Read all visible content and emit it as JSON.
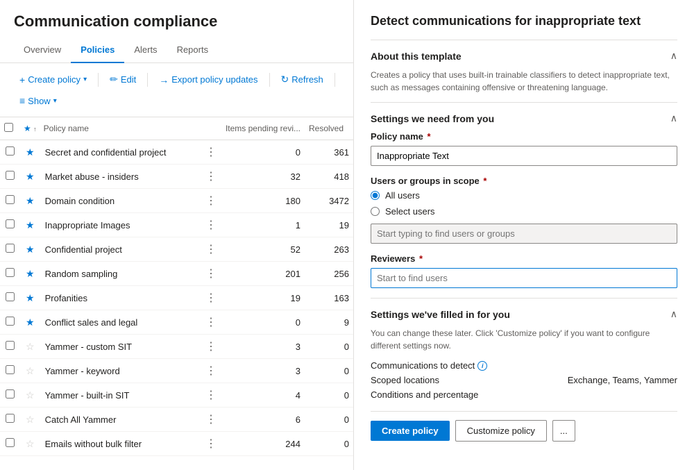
{
  "app": {
    "title": "Communication compliance"
  },
  "nav": {
    "tabs": [
      {
        "id": "overview",
        "label": "Overview",
        "active": false
      },
      {
        "id": "policies",
        "label": "Policies",
        "active": true
      },
      {
        "id": "alerts",
        "label": "Alerts",
        "active": false
      },
      {
        "id": "reports",
        "label": "Reports",
        "active": false
      }
    ]
  },
  "toolbar": {
    "create_label": "Create policy",
    "edit_label": "Edit",
    "export_label": "Export policy updates",
    "refresh_label": "Refresh",
    "show_label": "Show"
  },
  "table": {
    "headers": {
      "name": "Policy name",
      "items_pending": "Items pending revi...",
      "resolved": "Resolved"
    },
    "rows": [
      {
        "name": "Secret and confidential project",
        "starred": true,
        "items_pending": 0,
        "resolved": 361
      },
      {
        "name": "Market abuse - insiders",
        "starred": true,
        "items_pending": 32,
        "resolved": 418
      },
      {
        "name": "Domain condition",
        "starred": true,
        "items_pending": 180,
        "resolved": 3472
      },
      {
        "name": "Inappropriate Images",
        "starred": true,
        "items_pending": 1,
        "resolved": 19
      },
      {
        "name": "Confidential project",
        "starred": true,
        "items_pending": 52,
        "resolved": 263
      },
      {
        "name": "Random sampling",
        "starred": true,
        "items_pending": 201,
        "resolved": 256
      },
      {
        "name": "Profanities",
        "starred": true,
        "items_pending": 19,
        "resolved": 163
      },
      {
        "name": "Conflict sales and legal",
        "starred": true,
        "items_pending": 0,
        "resolved": 9
      },
      {
        "name": "Yammer - custom SIT",
        "starred": false,
        "items_pending": 3,
        "resolved": 0
      },
      {
        "name": "Yammer - keyword",
        "starred": false,
        "items_pending": 3,
        "resolved": 0
      },
      {
        "name": "Yammer - built-in SIT",
        "starred": false,
        "items_pending": 4,
        "resolved": 0
      },
      {
        "name": "Catch All Yammer",
        "starred": false,
        "items_pending": 6,
        "resolved": 0
      },
      {
        "name": "Emails without bulk filter",
        "starred": false,
        "items_pending": 244,
        "resolved": 0
      }
    ]
  },
  "right_panel": {
    "title": "Detect communications for inappropriate text",
    "about_section": {
      "label": "About this template",
      "description": "Creates a policy that uses built-in trainable classifiers to detect inappropriate text, such as messages containing offensive or threatening language."
    },
    "settings_section": {
      "label": "Settings we need from you",
      "policy_name_label": "Policy name",
      "policy_name_value": "Inappropriate Text",
      "users_label": "Users or groups in scope",
      "radio_all_users": "All users",
      "radio_select_users": "Select users",
      "users_placeholder": "Start typing to find users or groups",
      "reviewers_label": "Reviewers",
      "reviewers_placeholder": "Start to find users"
    },
    "filled_section": {
      "label": "Settings we've filled in for you",
      "description": "You can change these later. Click 'Customize policy' if you want to configure different settings now.",
      "comms_to_detect_label": "Communications to detect",
      "scoped_locations_label": "Scoped locations",
      "scoped_locations_value": "Exchange, Teams, Yammer",
      "conditions_label": "Conditions and percentage"
    },
    "actions": {
      "create_policy": "Create policy",
      "customize_policy": "Customize policy",
      "more_label": "..."
    }
  }
}
